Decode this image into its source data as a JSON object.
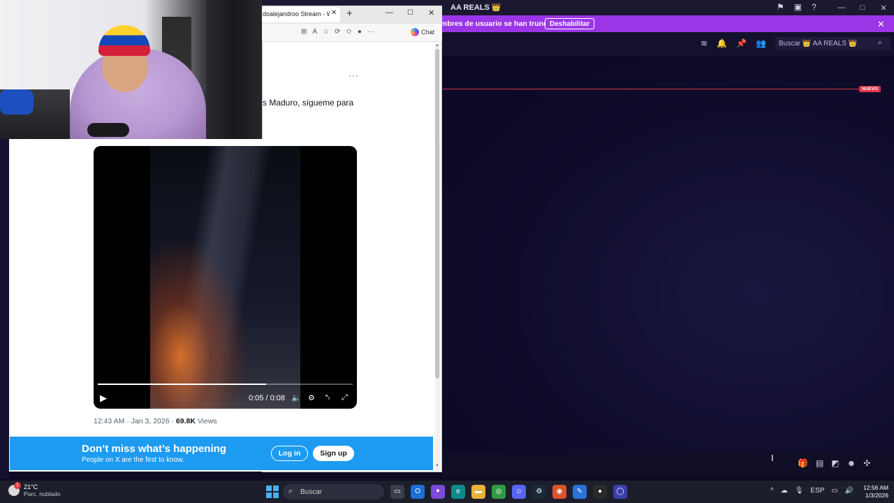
{
  "app": {
    "title": "AA REALS 👑",
    "window_controls": [
      "—",
      "□",
      "✕"
    ],
    "top_icons": [
      "inbox-icon",
      "screen-icon",
      "help-icon"
    ]
  },
  "banner": {
    "text": "mbres de usuario se han truncado.",
    "button_label": "Deshabilitar",
    "close": "✕"
  },
  "toolbar": {
    "search_placeholder": "Buscar 👑 AA REALS 👑"
  },
  "chat": {
    "new_badge": "NUEVO"
  },
  "browser": {
    "tab_title": "doalejandroo Stream - Wat",
    "tab_close": "✕",
    "new_tab": "+",
    "win_min": "—",
    "win_max": "☐",
    "win_close": "✕",
    "chat_label": "Chat"
  },
  "tweet": {
    "more": "···",
    "text": "s Maduro, sígueme para",
    "time": "12:43 AM · Jan 3, 2026 · ",
    "views_count": "69.8K",
    "views_label": " Views"
  },
  "video": {
    "time": "0:05 / 0:08",
    "progress": 0.66
  },
  "x_banner": {
    "title": "Don’t miss what’s happening",
    "subtitle": "People on X are the first to know.",
    "login": "Log in",
    "signup": "Sign up"
  },
  "taskbar": {
    "weather_badge": "1",
    "temp": "21°C",
    "condition": "Parc. nublado",
    "search": "Buscar",
    "lang": "ESP",
    "time": "12:56 AM",
    "date": "1/3/2026"
  }
}
